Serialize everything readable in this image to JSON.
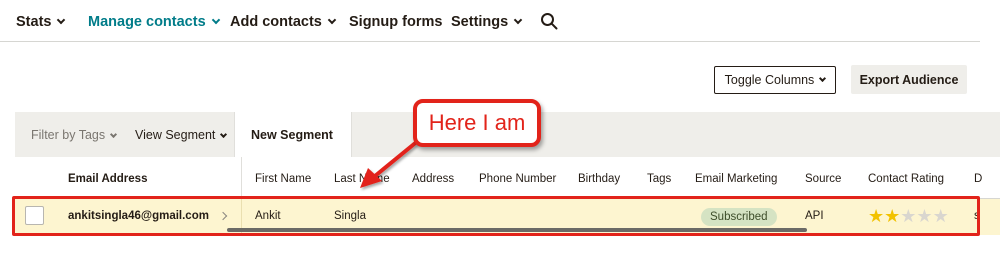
{
  "nav": {
    "stats": "Stats",
    "manage_contacts": "Manage contacts",
    "add_contacts": "Add contacts",
    "signup_forms": "Signup forms",
    "settings": "Settings"
  },
  "actions": {
    "toggle_columns": "Toggle Columns",
    "export_audience": "Export Audience"
  },
  "toolbar": {
    "filter_by_tags": "Filter by Tags",
    "view_segment": "View Segment",
    "new_segment": "New Segment"
  },
  "table": {
    "headers": {
      "email": "Email Address",
      "first_name": "First Name",
      "last_name": "Last Name",
      "address": "Address",
      "phone": "Phone Number",
      "birthday": "Birthday",
      "tags": "Tags",
      "email_marketing": "Email Marketing",
      "source": "Source",
      "contact_rating": "Contact Rating",
      "truncated": "D"
    },
    "rows": [
      {
        "email": "ankitsingla46@gmail.com",
        "first_name": "Ankit",
        "last_name": "Singla",
        "email_marketing": "Subscribed",
        "source": "API",
        "rating": 2,
        "rating_max": 5,
        "truncated": "s"
      }
    ]
  },
  "annotation": {
    "callout": "Here I am",
    "color": "#e2231a"
  },
  "colors": {
    "accent": "#007c89",
    "row_highlight": "#fdf5d0",
    "badge_bg": "#d5e3c3",
    "star_on": "#f2c200",
    "star_off": "#d9d6cf"
  }
}
